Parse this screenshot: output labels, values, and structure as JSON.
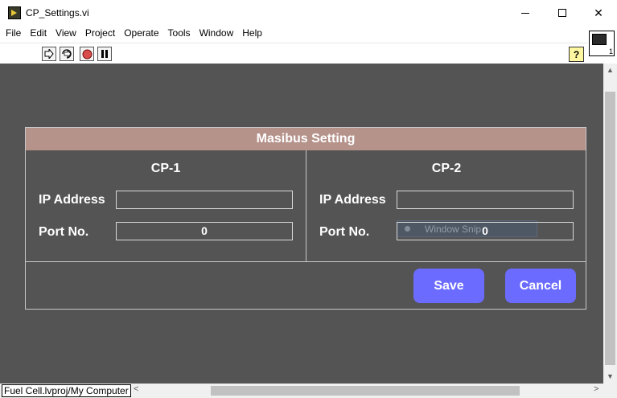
{
  "window": {
    "title": "CP_Settings.vi"
  },
  "menu": [
    "File",
    "Edit",
    "View",
    "Project",
    "Operate",
    "Tools",
    "Window",
    "Help"
  ],
  "toolbar": {
    "help_label": "?",
    "vi_icon_number": "1"
  },
  "setting": {
    "header": "Masibus Setting",
    "cp1": {
      "title": "CP-1",
      "ip_label": "IP Address",
      "ip_value": "",
      "port_label": "Port No.",
      "port_value": "0"
    },
    "cp2": {
      "title": "CP-2",
      "ip_label": "IP Address",
      "ip_value": "",
      "port_label": "Port No.",
      "port_value": "0"
    },
    "save_label": "Save",
    "cancel_label": "Cancel"
  },
  "overlay": {
    "snip_label": "Window Snip"
  },
  "statusbar": {
    "path": "Fuel Cell.lvproj/My Computer"
  },
  "colors": {
    "panel_bg": "#545454",
    "header_bg": "#b5938b",
    "button_bg": "#6b6bff"
  }
}
